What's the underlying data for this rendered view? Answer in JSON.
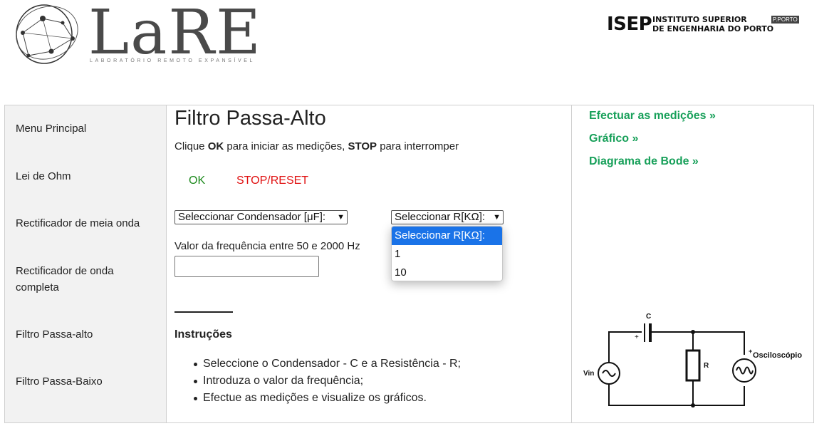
{
  "header": {
    "logo_text": "LaRE",
    "logo_subtitle": "LABORATÓRIO REMOTO EXPANSÍVEL",
    "isep_abbr": "ISEP",
    "isep_line1": "INSTITUTO SUPERIOR",
    "isep_line2": "DE ENGENHARIA DO PORTO",
    "porto_tag": "P.PORTO"
  },
  "sidebar": {
    "items": [
      {
        "label": "Menu Principal"
      },
      {
        "label": "Lei de Ohm"
      },
      {
        "label": "Rectificador de meia onda"
      },
      {
        "label": "Rectificador de onda completa"
      },
      {
        "label": "Filtro Passa-alto"
      },
      {
        "label": "Filtro Passa-Baixo"
      }
    ]
  },
  "main": {
    "title": "Filtro Passa-Alto",
    "instr_prefix": "Clique ",
    "instr_ok": "OK",
    "instr_mid": " para iniciar as medições, ",
    "instr_stop": "STOP",
    "instr_suffix": " para interromper",
    "ok_button": "OK",
    "stop_button": "STOP/RESET",
    "capacitor_select": {
      "value": "Seleccionar Condensador [μF]:"
    },
    "resistor_select": {
      "value": "Seleccionar R[KΩ]:",
      "options": [
        "Seleccionar R[KΩ]:",
        "1",
        "10"
      ],
      "highlighted_index": 0
    },
    "freq_label": "Valor da frequência entre 50 e 2000 Hz",
    "freq_value": "",
    "instructions_heading": "Instruções",
    "instructions": [
      "Seleccione o Condensador - C e a Resistência - R;",
      "Introduza o valor da frequência;",
      "Efectue as medições e visualize os gráficos."
    ]
  },
  "right_panel": {
    "links": [
      {
        "label": "Efectuar as medições »"
      },
      {
        "label": "Gráfico »"
      },
      {
        "label": "Diagrama de Bode »"
      }
    ],
    "circuit": {
      "capacitor_label": "C",
      "plus_sign": "+",
      "resistor_label": "R",
      "source_label": "Vin",
      "scope_label": "Osciloscópio",
      "scope_plus": "+"
    }
  }
}
